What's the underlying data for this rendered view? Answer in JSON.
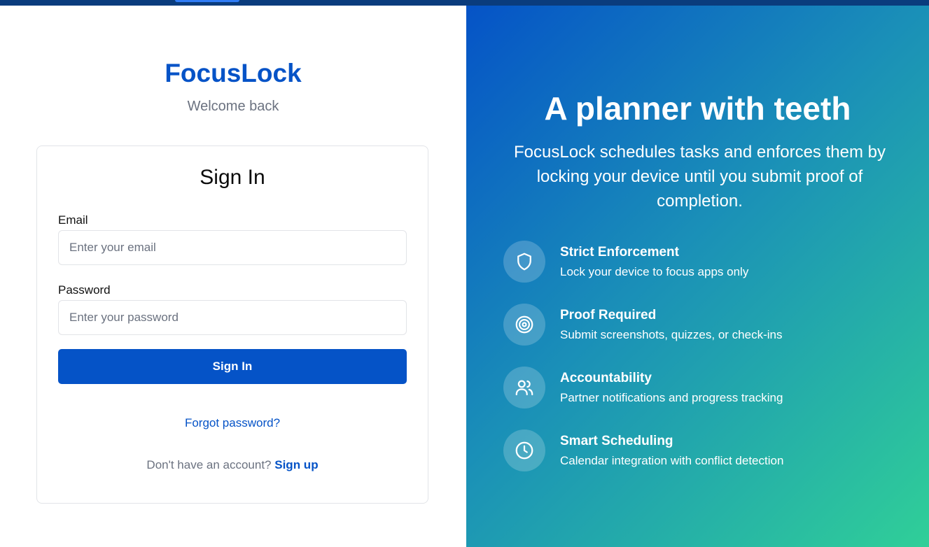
{
  "brand": {
    "name": "FocusLock",
    "tagline": "Welcome back"
  },
  "colors": {
    "primary": "#0553c7",
    "gradient_start": "#0553c7",
    "gradient_end": "#30cf98"
  },
  "signin": {
    "title": "Sign In",
    "email_label": "Email",
    "email_placeholder": "Enter your email",
    "email_value": "",
    "password_label": "Password",
    "password_placeholder": "Enter your password",
    "password_value": "",
    "submit_label": "Sign In",
    "forgot_link": "Forgot password?",
    "no_account_text": "Don't have an account?",
    "signup_link": "Sign up"
  },
  "hero": {
    "title": "A planner with teeth",
    "description": "FocusLock schedules tasks and enforces them by locking your device until you submit proof of completion.",
    "features": [
      {
        "icon": "shield-icon",
        "title": "Strict Enforcement",
        "description": "Lock your device to focus apps only"
      },
      {
        "icon": "target-icon",
        "title": "Proof Required",
        "description": "Submit screenshots, quizzes, or check-ins"
      },
      {
        "icon": "users-icon",
        "title": "Accountability",
        "description": "Partner notifications and progress tracking"
      },
      {
        "icon": "clock-icon",
        "title": "Smart Scheduling",
        "description": "Calendar integration with conflict detection"
      }
    ]
  }
}
